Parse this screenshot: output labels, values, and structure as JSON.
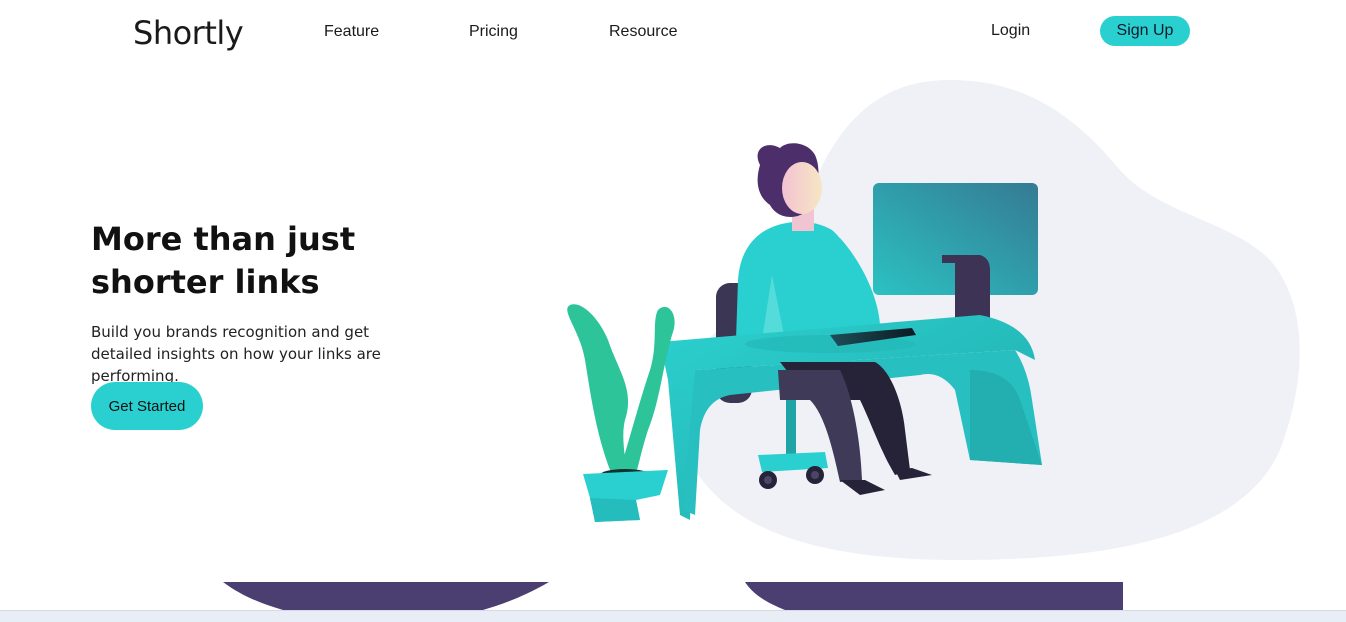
{
  "nav": {
    "logo": "Shortly",
    "links": [
      "Feature",
      "Pricing",
      "Resource"
    ],
    "login": "Login",
    "signup": "Sign Up"
  },
  "hero": {
    "title": "More than just shorter links",
    "subtitle": "Build you brands recognition and get detailed insights on how your links are performing.",
    "cta": "Get Started"
  },
  "colors": {
    "accent": "#2ad0cf",
    "dark_violet": "#4b3f72",
    "blob": "#eff1f7"
  },
  "illustration": {
    "icon": "person-working-at-desk-icon"
  }
}
